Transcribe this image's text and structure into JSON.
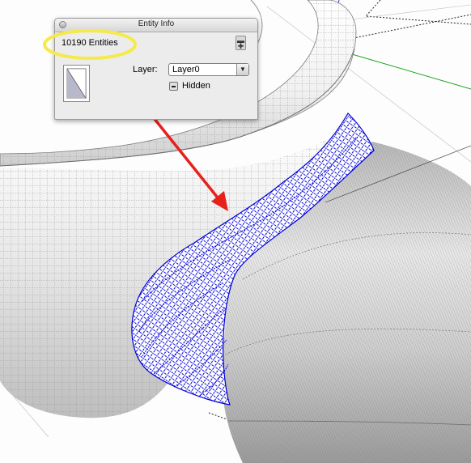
{
  "window": {
    "title": "Entity Info",
    "close_icon": "close-icon"
  },
  "entity_info": {
    "entity_count": "10190 Entities",
    "layer_label": "Layer:",
    "layer_value": "Layer0",
    "hidden_label": "Hidden",
    "hidden_checked": "mixed"
  },
  "colors": {
    "callout_circle": "#f5ea4a",
    "callout_arrow": "#e8201c",
    "selection": "#0000d8",
    "axis_red": "#d32020",
    "axis_green": "#1fa31f",
    "axis_blue": "#2233cc"
  }
}
